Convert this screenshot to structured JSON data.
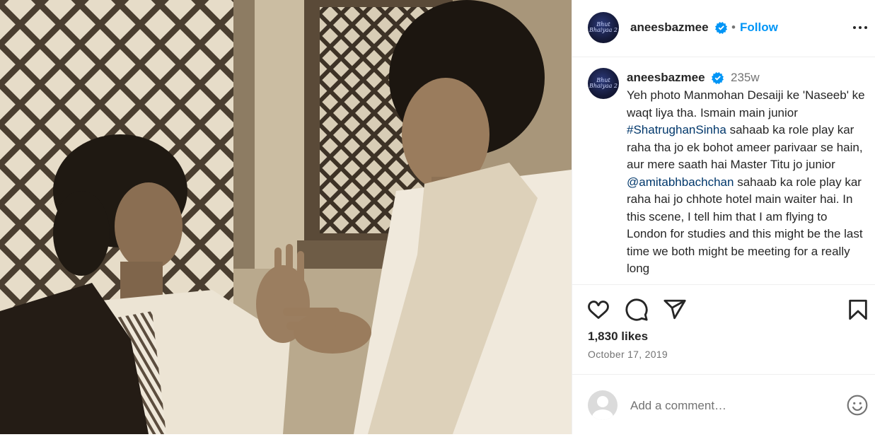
{
  "post": {
    "photo": {
      "icon": "vintage-photo"
    },
    "header": {
      "avatar_text": "Bhut Bhaiyaa 2",
      "username": "aneesbazmee",
      "separator": "•",
      "follow_label": "Follow",
      "verified_icon": "verified-badge-icon",
      "more_icon": "more-options-icon"
    },
    "caption": {
      "username": "aneesbazmee",
      "time_ago": "235w",
      "part1": "Yeh photo Manmohan Desaiji ke 'Naseeb' ke waqt liya tha. Ismain main junior ",
      "hashtag": "#ShatrughanSinha",
      "part2": " sahaab ka role play kar raha tha jo ek bohot ameer parivaar se hain, aur mere saath hai Master Titu jo junior ",
      "mention": "@amitabhbachchan",
      "part3": " sahaab ka role play kar raha hai jo chhote hotel main waiter hai. In this scene, I tell him that I am flying to London for studies and this might be the last time we both might be meeting for a really long"
    },
    "actions": {
      "like_icon": "heart-icon",
      "comment_icon": "comment-icon",
      "share_icon": "share-icon",
      "save_icon": "bookmark-icon"
    },
    "likes": "1,830 likes",
    "date": "October 17, 2019",
    "comment": {
      "placeholder": "Add a comment…",
      "emoji_icon": "emoji-icon"
    },
    "colors": {
      "link": "#0095f6",
      "verified": "#0095f6",
      "hashtag": "#00376b",
      "muted": "#737373",
      "border": "#efefef"
    }
  }
}
